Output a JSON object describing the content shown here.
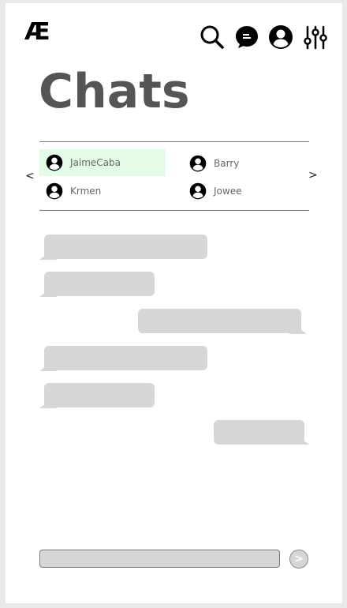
{
  "header": {
    "logo": "Æ",
    "icons": [
      "search-icon",
      "chat-icon",
      "profile-icon",
      "filter-settings-icon"
    ]
  },
  "page_title": "Chats",
  "contacts": {
    "prev_label": "<",
    "next_label": ">",
    "selected": "JaimeCaba",
    "selected_color": "#e3fbe7",
    "items": [
      {
        "name": "JaimeCaba"
      },
      {
        "name": "Barry"
      },
      {
        "name": "Krmen"
      },
      {
        "name": "Jowee"
      }
    ]
  },
  "messages": [
    {
      "side": "left"
    },
    {
      "side": "left"
    },
    {
      "side": "right"
    },
    {
      "side": "left"
    },
    {
      "side": "left"
    },
    {
      "side": "right"
    }
  ],
  "composer": {
    "value": "",
    "placeholder": "",
    "send_label": ">"
  },
  "colors": {
    "bubble": "#d6d6d6",
    "title": "#555555"
  }
}
